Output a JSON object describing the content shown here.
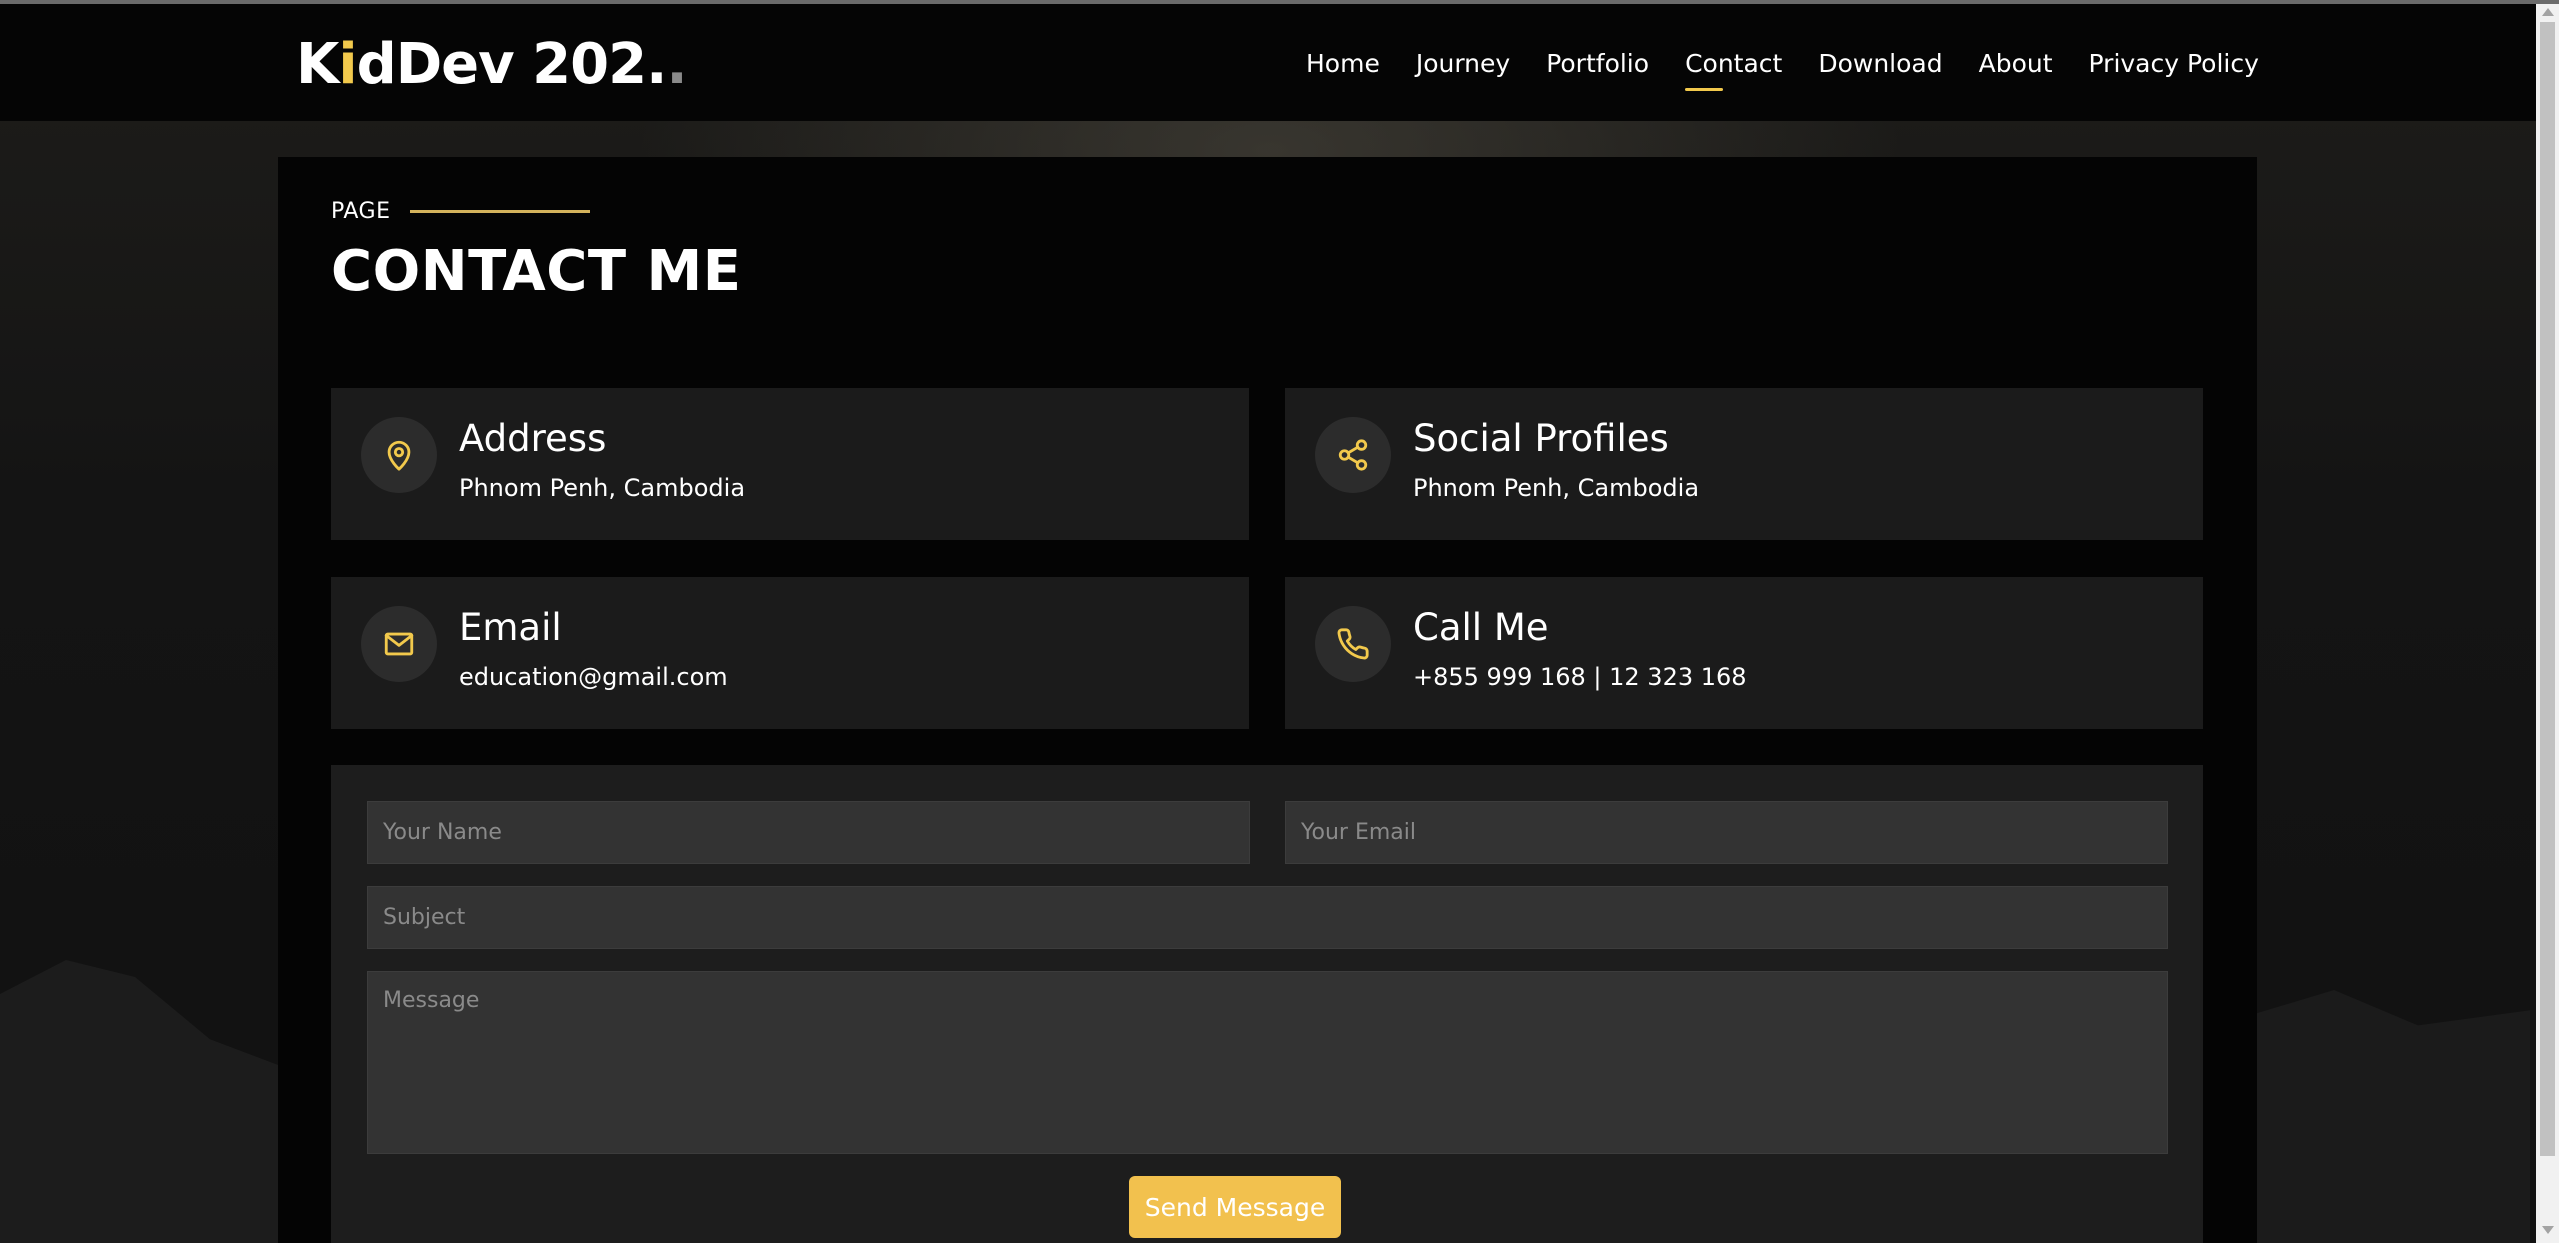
{
  "colors": {
    "accent": "#f2c94c",
    "button": "#f2c14e",
    "card": "#1b1b1b",
    "field": "#333333"
  },
  "header": {
    "logo": {
      "part1": "K",
      "accent": "i",
      "part2": "dDev 202",
      "dot1": ".",
      "dot2": "."
    },
    "nav": [
      {
        "label": "Home"
      },
      {
        "label": "Journey"
      },
      {
        "label": "Portfolio"
      },
      {
        "label": "Contact",
        "active": true
      },
      {
        "label": "Download"
      },
      {
        "label": "About"
      },
      {
        "label": "Privacy Policy"
      }
    ]
  },
  "page": {
    "label": "PAGE",
    "title": "CONTACT ME"
  },
  "cards": [
    {
      "icon": "location-pin-icon",
      "title": "Address",
      "value": "Phnom Penh, Cambodia"
    },
    {
      "icon": "share-icon",
      "title": "Social Profiles",
      "value": "Phnom Penh, Cambodia"
    },
    {
      "icon": "mail-icon",
      "title": "Email",
      "value": "education@gmail.com"
    },
    {
      "icon": "phone-icon",
      "title": "Call Me",
      "value": "+855 999 168 | 12 323 168"
    }
  ],
  "form": {
    "name_placeholder": "Your Name",
    "email_placeholder": "Your Email",
    "subject_placeholder": "Subject",
    "message_placeholder": "Message",
    "submit_label": "Send Message"
  }
}
